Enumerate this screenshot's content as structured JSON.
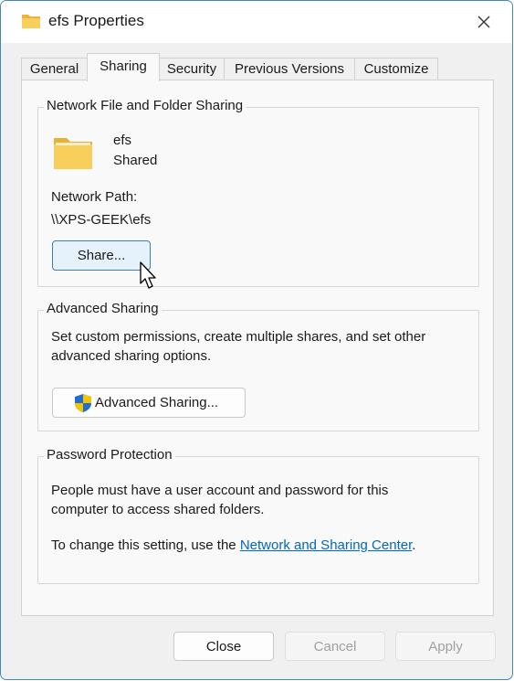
{
  "window": {
    "title": "efs Properties"
  },
  "tabs": [
    {
      "label": "General"
    },
    {
      "label": "Sharing",
      "active": true
    },
    {
      "label": "Security"
    },
    {
      "label": "Previous Versions"
    },
    {
      "label": "Customize"
    }
  ],
  "network_sharing": {
    "group_title": "Network File and Folder Sharing",
    "folder_name": "efs",
    "status": "Shared",
    "path_label": "Network Path:",
    "path_value": "\\\\XPS-GEEK\\efs",
    "share_button": "Share..."
  },
  "advanced_sharing": {
    "group_title": "Advanced Sharing",
    "description_line1": "Set custom permissions, create multiple shares, and set other",
    "description_line2": "advanced sharing options.",
    "button_label": "Advanced Sharing..."
  },
  "password_protection": {
    "group_title": "Password Protection",
    "line1": "People must have a user account and password for this",
    "line2": "computer to access shared folders.",
    "change_prefix": "To change this setting, use the ",
    "link_text": "Network and Sharing Center",
    "change_suffix": "."
  },
  "footer": {
    "close": "Close",
    "cancel": "Cancel",
    "apply": "Apply"
  },
  "colors": {
    "accent": "#0067c0",
    "focus_border": "#3c7fb1",
    "folder": "#f5c542"
  },
  "icons": {
    "folder": "folder-icon",
    "close": "close-icon",
    "uac_shield": "uac-shield-icon",
    "cursor": "mouse-cursor-icon"
  }
}
